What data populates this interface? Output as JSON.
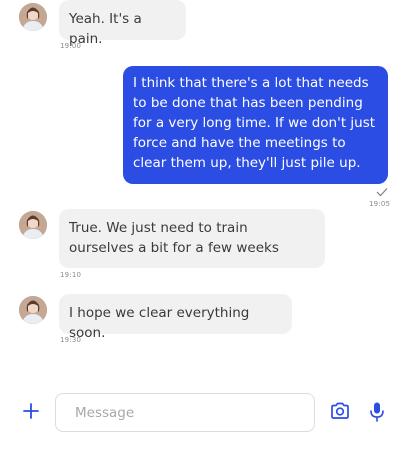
{
  "messages": [
    {
      "text": "Yeah. It's a pain.",
      "time": "19:00"
    },
    {
      "text": "I think that there's a lot that needs to be done that has been pending for a very long time. If we don't just force and have the meetings to clear them up, they'll just pile up.",
      "time": "19:05"
    },
    {
      "text": "True. We just need to train ourselves a bit for a few weeks",
      "time": "19:10"
    },
    {
      "text": "I hope we clear everything soon.",
      "time": "19:30"
    }
  ],
  "composer": {
    "placeholder": "Message"
  },
  "icons": {
    "add": "plus-icon",
    "camera": "camera-icon",
    "mic": "microphone-icon",
    "read": "check-icon"
  },
  "colors": {
    "accent": "#2b4de3",
    "incoming_bubble": "#f1f1f1"
  }
}
